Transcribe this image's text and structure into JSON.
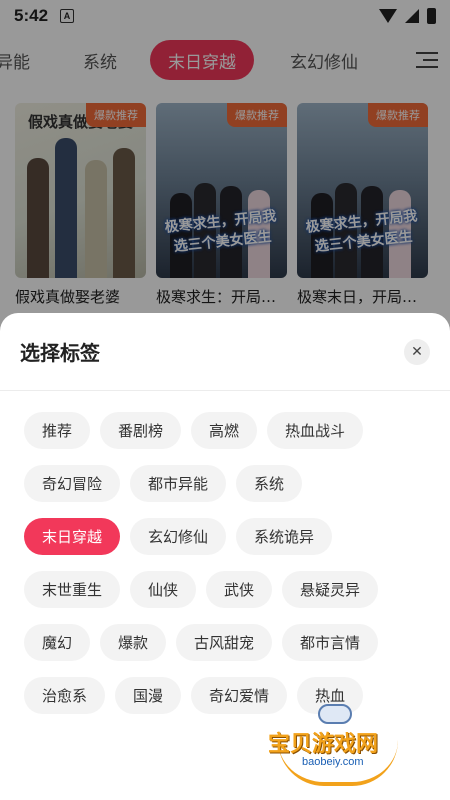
{
  "status_bar": {
    "time": "5:42",
    "notification_letter": "A"
  },
  "top_tabs": [
    {
      "label": "异能",
      "active": false
    },
    {
      "label": "系统",
      "active": false
    },
    {
      "label": "末日穿越",
      "active": true
    },
    {
      "label": "玄幻修仙",
      "active": false
    }
  ],
  "cards": [
    {
      "title": "假戏真做娶老婆",
      "badge": "爆款推荐",
      "cover_text": "假戏真做娶老婆"
    },
    {
      "title": "极寒求生：开局…",
      "badge": "爆款推荐",
      "cover_text": "极寒求生，开局我选三个美女医生"
    },
    {
      "title": "极寒末日，开局…",
      "badge": "爆款推荐",
      "cover_text": "极寒求生，开局我选三个美女医生"
    }
  ],
  "sheet": {
    "title": "选择标签",
    "close_symbol": "✕",
    "tag_rows": [
      [
        {
          "label": "推荐",
          "selected": false
        },
        {
          "label": "番剧榜",
          "selected": false
        },
        {
          "label": "高燃",
          "selected": false
        },
        {
          "label": "热血战斗",
          "selected": false
        }
      ],
      [
        {
          "label": "奇幻冒险",
          "selected": false
        },
        {
          "label": "都市异能",
          "selected": false
        },
        {
          "label": "系统",
          "selected": false
        }
      ],
      [
        {
          "label": "末日穿越",
          "selected": true
        },
        {
          "label": "玄幻修仙",
          "selected": false
        },
        {
          "label": "系统诡异",
          "selected": false
        }
      ],
      [
        {
          "label": "末世重生",
          "selected": false
        },
        {
          "label": "仙侠",
          "selected": false
        },
        {
          "label": "武侠",
          "selected": false
        },
        {
          "label": "悬疑灵异",
          "selected": false
        }
      ],
      [
        {
          "label": "魔幻",
          "selected": false
        },
        {
          "label": "爆款",
          "selected": false
        },
        {
          "label": "古风甜宠",
          "selected": false
        },
        {
          "label": "都市言情",
          "selected": false
        }
      ],
      [
        {
          "label": "治愈系",
          "selected": false
        },
        {
          "label": "国漫",
          "selected": false
        },
        {
          "label": "奇幻爱情",
          "selected": false
        },
        {
          "label": "热血",
          "selected": false
        }
      ]
    ]
  },
  "watermark": {
    "main": "宝贝游戏网",
    "sub": "baobeiy.com"
  },
  "colors": {
    "accent": "#f2385a",
    "badge": "#f26b3a",
    "tag_bg": "#f3f3f3"
  }
}
